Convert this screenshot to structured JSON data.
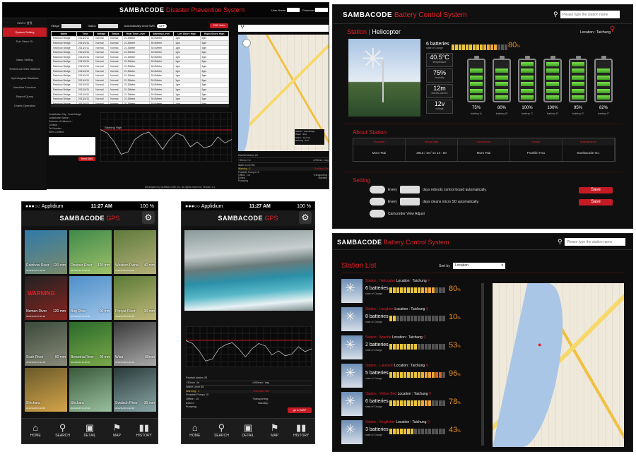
{
  "panel_a": {
    "brand": "SAMBACODE",
    "title": "Disaster Prevention System",
    "username_label": "User Name",
    "password_label": "Password",
    "sidebar": [
      "INDEX 首頁",
      "System Setting",
      "Sub Obsrv St.",
      "",
      "Basic Setting",
      "Reference Web Material",
      "Hydrological Statistics",
      "Machine Function",
      "Report Query",
      "Charts Operation"
    ],
    "filter_village": "Village",
    "filter_status": "Status",
    "auto_send": "Automatically send SMS",
    "auto_off": "OFF",
    "sms_btn": "SGB Video",
    "columns": [
      "Name",
      "Time",
      "Voltage",
      "Status",
      "Real Time Level",
      "Warning Level",
      "Left Shore High",
      "Right Shore High"
    ],
    "rows": [
      [
        "Rainbow Bridge",
        "2013/4/11",
        "Normal",
        "Normal",
        "21.3Meter",
        "30.0Meter",
        "1gm",
        "5gm"
      ],
      [
        "Rainbow Bridge",
        "2013/4/11",
        "Normal",
        "Normal",
        "21.3Meter",
        "30.0Meter",
        "1gm",
        "5gm"
      ],
      [
        "Rainbow Bridge",
        "2013/4/11",
        "Normal",
        "Normal",
        "21.3Meter",
        "30.0Meter",
        "1gm",
        "5gm"
      ],
      [
        "Rainbow Bridge",
        "2013/4/11",
        "Normal",
        "Normal",
        "21.3Meter",
        "30.0Meter",
        "1gm",
        "5gm"
      ],
      [
        "Rainbow Bridge",
        "2013/4/11",
        "Normal",
        "Normal",
        "21.3Meter",
        "30.0Meter",
        "1gm",
        "5gm"
      ],
      [
        "Rainbow Bridge",
        "2013/4/11",
        "Normal",
        "Normal",
        "21.3Meter",
        "30.0Meter",
        "1gm",
        "5gm"
      ],
      [
        "Rainbow Bridge",
        "2013/4/11",
        "Normal",
        "Normal",
        "21.3Meter",
        "30.0Meter",
        "1gm",
        "5gm"
      ],
      [
        "Rainbow Bridge",
        "2013/4/11",
        "Normal",
        "Normal",
        "21.3Meter",
        "30.0Meter",
        "1gm",
        "5gm"
      ],
      [
        "Rainbow Bridge",
        "2013/4/11",
        "Normal",
        "Normal",
        "21.3Meter",
        "30.0Meter",
        "1gm",
        "5gm"
      ],
      [
        "Rainbow Bridge",
        "2013/4/11",
        "Normal",
        "Normal",
        "21.3Meter",
        "30.0Meter",
        "1gm",
        "5gm"
      ],
      [
        "Rainbow Bridge",
        "2013/4/11",
        "Normal",
        "Normal",
        "21.3Meter",
        "30.0Meter",
        "1gm",
        "5gm"
      ],
      [
        "Rainbow Bridge",
        "2013/4/11",
        "Normal",
        "Normal",
        "21.3Meter",
        "30.0Meter",
        "1gm",
        "5gm"
      ],
      [
        "Rainbow Bridge",
        "2013/4/11",
        "Normal",
        "Normal",
        "21.3Meter",
        "30.0Meter",
        "1gm",
        "5gm"
      ],
      [
        "Rainbow Bridge",
        "2013/4/11",
        "Normal",
        "Normal",
        "21.3Meter",
        "30.0Meter",
        "1gm",
        "5gm"
      ],
      [
        "Rainbow Bridge",
        "2013/4/11",
        "Normal",
        "Normal",
        "21.3Meter",
        "30.0Meter",
        "1gm",
        "5gm"
      ]
    ],
    "contact_lines": [
      "Jurisdiction City : Sust Bridge",
      "Jurisdiction Name :",
      "Scheme of Influence :",
      "Contact :",
      "Tel Number",
      "SMS Content"
    ],
    "send_btn": "Send SMS",
    "chart_warn": "Warning High",
    "rainfall": "Rainfall station 25",
    "rain_a": "+30mm / hr",
    "rain_b": ">200mm / day",
    "water_level": "Water Level 55",
    "warning": "Warning : 1",
    "overflow": "Overflow Site",
    "pumps": "Portable Pumps 10",
    "offline": "Offline : 10",
    "transport": "Transporting :",
    "exited": "Exited :",
    "standby": "Standby :",
    "pumping": "Pumping",
    "map_popup": [
      "Station : Sust Bridge",
      "Water : 31m",
      "Status : Normal",
      "Warning : 30m"
    ],
    "footer": "Developed by SAMBACODE Inc. All rights reserved. Version 1.0"
  },
  "panel_b": {
    "brand": "SAMBACODE",
    "title": "Battery Control System",
    "search_placeholder": "Please type the station name",
    "station_word": "Station",
    "station_name": "Helicopter",
    "location": "Location : Taichung",
    "batteries_count": "6 batteries",
    "batteries_sub": "state of Charge",
    "charge_pct": "80",
    "temp": "40.5°C",
    "temp_label": "temperature",
    "humidity": "75%",
    "humidity_label": "humidity",
    "current": "12m",
    "current_label": "electric current",
    "voltage": "12v",
    "voltage_label": "voltage",
    "batteries": [
      {
        "pct": "75%",
        "name": "battery A",
        "level": 0.75
      },
      {
        "pct": "80%",
        "name": "battery B",
        "level": 0.8
      },
      {
        "pct": "100%",
        "name": "battery C",
        "level": 1.0
      },
      {
        "pct": "100%",
        "name": "battery D",
        "level": 1.0
      },
      {
        "pct": "95%",
        "name": "battery E",
        "level": 0.95
      },
      {
        "pct": "82%",
        "name": "battery F",
        "level": 0.82
      }
    ],
    "about_title": "About Station",
    "about_headers": [
      "Proposer",
      "Setup Date",
      "Constructor",
      "Vendor",
      "Maintenance"
    ],
    "about_values": [
      "Moro Tsai",
      "2013 / 10 / 14  14 : 00",
      "Moro Tsai",
      "Franklin Hsu",
      "Sambacode Inc."
    ],
    "setting_title": "Setting",
    "setting_every": "Every",
    "setting_1": "days reboots control board automatically.",
    "setting_2": "days cleans micro SD automatically.",
    "setting_3": "Camcorder View Adjust",
    "save": "Save"
  },
  "phone1": {
    "carrier": "Applidium",
    "time": "11:27 AM",
    "battery": "100 %",
    "brand": "SAMBACODE",
    "brand_accent": "GPS",
    "tiles": [
      {
        "name": "Rainbow River",
        "mm": "120 mm",
        "date": "2013/11/20 11:22:33",
        "c1": "#2f7aa8",
        "c2": "#7a8a6a",
        "warn": ""
      },
      {
        "name": "Dneiper River",
        "mm": "120 mm",
        "date": "2013/11/20 11:22:33",
        "c1": "#3f8a4a",
        "c2": "#9fc06a",
        "warn": ""
      },
      {
        "name": "Western Dvina",
        "mm": "40 mm",
        "date": "2013/11/20 11:22:33",
        "c1": "#5e7a3a",
        "c2": "#b4b07a",
        "warn": ""
      },
      {
        "name": "Neman River",
        "mm": "120 mm",
        "date": "2013/11/20 11:22:33",
        "c1": "#222",
        "c2": "#8a2420",
        "warn": "WARNING"
      },
      {
        "name": "Bug River",
        "mm": "00 mm",
        "date": "2013/11/20 11:22:33",
        "c1": "#4f8fc8",
        "c2": "#9fc4e8",
        "warn": ""
      },
      {
        "name": "Pripyat River",
        "mm": "30 mm",
        "date": "2013/11/20 11:22:33",
        "c1": "#5a7a36",
        "c2": "#c0b87a",
        "warn": ""
      },
      {
        "name": "Sozh River",
        "mm": "00 mm",
        "date": "2013/11/20 11:22:33",
        "c1": "#3a4a3a",
        "c2": "#8a8a7a",
        "warn": ""
      },
      {
        "name": "Berezina River",
        "mm": "00 mm",
        "date": "2013/11/20 11:22:33",
        "c1": "#2a6a2a",
        "c2": "#7aa84a",
        "warn": ""
      },
      {
        "name": "Wisa",
        "mm": "80mm",
        "date": "2013/11/20 11:22:33",
        "c1": "#3a3a3a",
        "c2": "#aaaaaa",
        "warn": ""
      },
      {
        "name": "Shichara",
        "mm": "",
        "date": "2013/11/20 11:22:33",
        "c1": "#6a5a2a",
        "c2": "#d4a44a",
        "warn": ""
      },
      {
        "name": "Shchara",
        "mm": "",
        "date": "2013/11/20 11:22:33",
        "c1": "#3a5a3a",
        "c2": "#9ac0a0",
        "warn": ""
      },
      {
        "name": "Svislach River",
        "mm": "30 mm",
        "date": "2013/11/20 11:22:33",
        "c1": "#2a3a3a",
        "c2": "#8aa8a8",
        "warn": ""
      }
    ],
    "tabs": [
      "HOME",
      "SEARCH",
      "DETAIL",
      "MAP",
      "HISTORY"
    ]
  },
  "phone2": {
    "carrier": "Applidium",
    "time": "11:27 AM",
    "battery": "100 %",
    "brand": "SAMBACODE",
    "brand_accent": "GPS",
    "rainfall": "Rainfall station 25",
    "rain_a": "+30mm / hr",
    "rain_b": ">200mm / day",
    "water_level": "Water Level 55",
    "warning": "Warning : 1",
    "overflow": "Overflow Site",
    "pumps": "Portable Pumps 10",
    "offline": "Offline : 10",
    "exited": "Exited :",
    "pumping": "Pumping",
    "transporting": "Transporting :",
    "standby": "Standby :",
    "map_btn": "go to MAP",
    "tabs": [
      "HOME",
      "SEARCH",
      "DETAIL",
      "MAP",
      "HISTORY"
    ]
  },
  "panel_e": {
    "brand": "SAMBACODE",
    "title": "Battery Control System",
    "search_placeholder": "Please type the station name",
    "list_title": "Station List",
    "sort_label": "Sort by",
    "sort_value": "Location",
    "stations": [
      {
        "name": "Helicopter",
        "loc": "Location : Taichung",
        "count": "6 batteries",
        "pct": "80",
        "level": 0.8
      },
      {
        "name": "Longbow",
        "loc": "Location : Taichung",
        "count": "8 batteries",
        "pct": "10",
        "level": 0.1
      },
      {
        "name": "Apache",
        "loc": "Location : Taichung",
        "count": "2 batteries",
        "pct": "53",
        "level": 0.53
      },
      {
        "name": "Lakeside",
        "loc": "Location : Taichung",
        "count": "5 batteries",
        "pct": "96",
        "level": 0.96
      },
      {
        "name": "Yellow Bird",
        "loc": "Location : Taichung",
        "count": "6 batteries",
        "pct": "78",
        "level": 0.78
      },
      {
        "name": "Kingfisher",
        "loc": "Location : Taichung",
        "count": "3 batteries",
        "pct": "43",
        "level": 0.43
      }
    ],
    "sub": "state of Charge"
  },
  "colors": {
    "accent": "#e0202a",
    "bg": "#0e0e0e",
    "bar": "#e8c33b",
    "battery": "#5fc83a"
  }
}
